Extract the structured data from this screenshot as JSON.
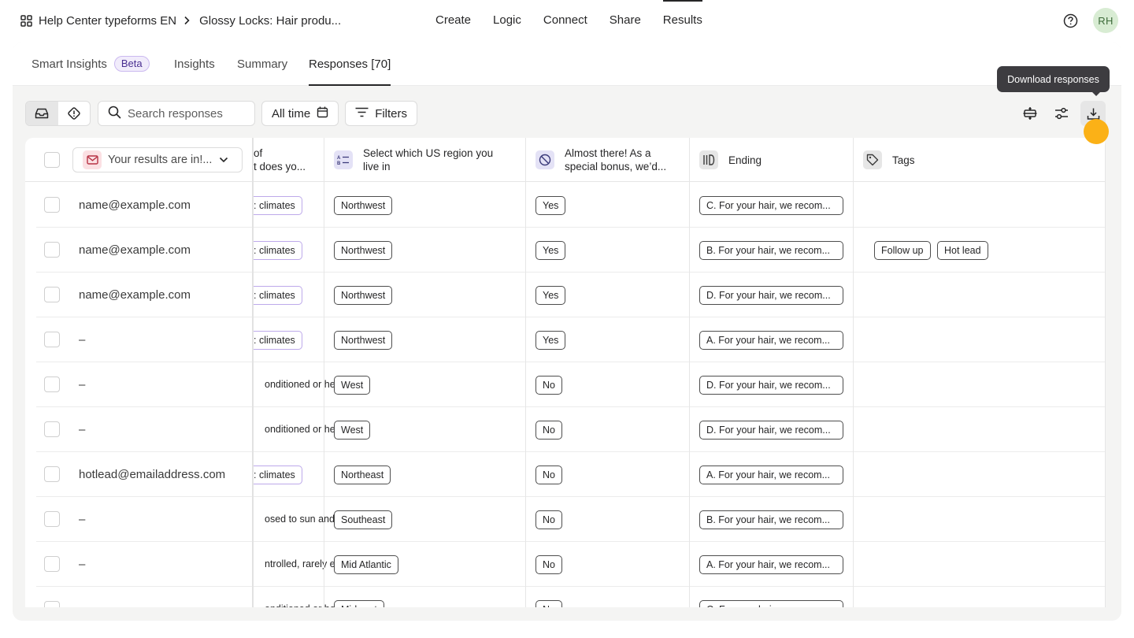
{
  "breadcrumb": {
    "workspace": "Help Center typeforms EN",
    "form": "Glossy Locks: Hair produ..."
  },
  "topnav": [
    "Create",
    "Logic",
    "Connect",
    "Share",
    "Results"
  ],
  "topnav_active": "Results",
  "user": {
    "initials": "RH"
  },
  "tabs": {
    "smart_insights": "Smart Insights",
    "beta": "Beta",
    "insights": "Insights",
    "summary": "Summary",
    "responses": "Responses [70]"
  },
  "toolbar": {
    "search_placeholder": "Search responses",
    "time_filter": "All time",
    "filters": "Filters"
  },
  "tooltip": "Download responses",
  "columns": {
    "email_question": "Your results are in!...",
    "prev_question_line1": "of",
    "prev_question_line2": "t does yo...",
    "region_line1": "Select which US region you",
    "region_line2": "live in",
    "bonus_line1": "Almost there! As a",
    "bonus_line2": "special bonus, we’d...",
    "ending": "Ending",
    "tags": "Tags"
  },
  "rows": [
    {
      "email": "name@example.com",
      "climate": ": climates",
      "region": "Northwest",
      "bonus": "Yes",
      "ending": "C. For your hair, we recom...",
      "tags": []
    },
    {
      "email": "name@example.com",
      "climate": ": climates",
      "region": "Northwest",
      "bonus": "Yes",
      "ending": "B. For your hair, we recom...",
      "tags": [
        "Follow up",
        "Hot lead"
      ]
    },
    {
      "email": "name@example.com",
      "climate": ": climates",
      "region": "Northwest",
      "bonus": "Yes",
      "ending": "D. For your hair, we recom...",
      "tags": []
    },
    {
      "email": "–",
      "climate": ": climates",
      "region": "Northwest",
      "bonus": "Yes",
      "ending": "A. For your hair, we recom...",
      "tags": []
    },
    {
      "email": "–",
      "climate": "onditioned or hea",
      "region": "West",
      "bonus": "No",
      "ending": "D. For your hair, we recom...",
      "tags": []
    },
    {
      "email": "–",
      "climate": "onditioned or hea",
      "region": "West",
      "bonus": "No",
      "ending": "D. For your hair, we recom...",
      "tags": []
    },
    {
      "email": "hotlead@emailaddress.com",
      "climate": ": climates",
      "region": "Northeast",
      "bonus": "No",
      "ending": "A. For your hair, we recom...",
      "tags": []
    },
    {
      "email": "–",
      "climate": "osed to sun and",
      "region": "Southeast",
      "bonus": "No",
      "ending": "B. For your hair, we recom...",
      "tags": []
    },
    {
      "email": "–",
      "climate": "ntrolled, rarely e",
      "region": "Mid Atlantic",
      "bonus": "No",
      "ending": "A. For your hair, we recom...",
      "tags": []
    },
    {
      "email": "",
      "climate": "onditioned or hea",
      "region": "Midwest",
      "bonus": "No",
      "ending": "C. For your hair, we recom...",
      "tags": []
    }
  ],
  "colors": {
    "accent_cursor": "#fbb117",
    "tooltip_bg": "#3d3c40",
    "avatar_bg": "#d8ecd3",
    "climate_chip_border": "#bda9ea"
  }
}
